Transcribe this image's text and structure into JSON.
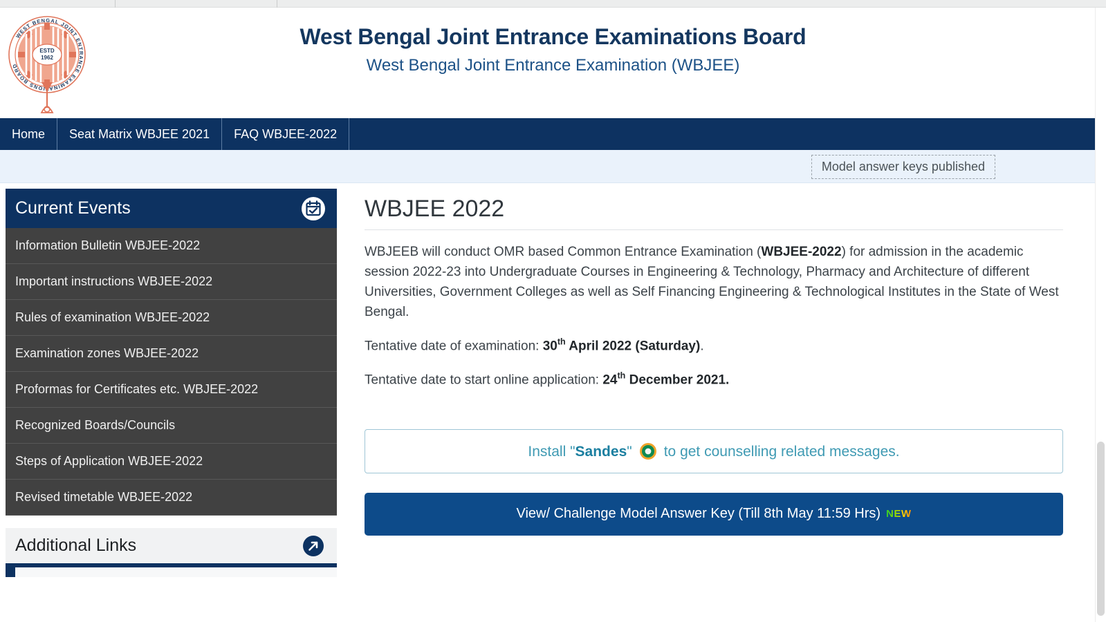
{
  "browser": {
    "tab_separators": [
      166,
      400
    ]
  },
  "header": {
    "logo_alt": "West Bengal Joint Entrance Examinations Board emblem",
    "logo_ring_text": "WEST BENGAL JOINT ENTRANCE EXAMINATIONS BOARD",
    "logo_estd_line1": "ESTD",
    "logo_estd_line2": "1962",
    "title": "West Bengal Joint Entrance Examinations Board",
    "subtitle": "West Bengal Joint Entrance Examination (WBJEE)"
  },
  "nav": {
    "items": [
      {
        "label": "Home"
      },
      {
        "label": "Seat Matrix WBJEE 2021"
      },
      {
        "label": "FAQ WBJEE-2022"
      }
    ]
  },
  "notice": {
    "text": "Model answer keys published"
  },
  "sidebar": {
    "current_events": {
      "title": "Current Events",
      "icon": "calendar-check-icon",
      "items": [
        {
          "label": "Information Bulletin WBJEE-2022"
        },
        {
          "label": "Important instructions WBJEE-2022"
        },
        {
          "label": "Rules of examination WBJEE-2022"
        },
        {
          "label": "Examination zones WBJEE-2022"
        },
        {
          "label": "Proformas for Certificates etc. WBJEE-2022"
        },
        {
          "label": "Recognized Boards/Councils"
        },
        {
          "label": "Steps of Application WBJEE-2022"
        },
        {
          "label": "Revised timetable WBJEE-2022"
        }
      ]
    },
    "additional_links": {
      "title": "Additional Links",
      "icon": "external-link-arrow-icon"
    }
  },
  "main": {
    "page_title": "WBJEE 2022",
    "intro_part1": "WBJEEB will conduct OMR based Common Entrance Examination (",
    "intro_bold": "WBJEE-2022",
    "intro_part2": ") for admission in the academic session 2022-23 into Undergraduate Courses in Engineering & Technology, Pharmacy and Architecture of different Universities, Government Colleges as well as Self Financing Engineering & Technological Institutes in the State of West Bengal.",
    "exam_date_label": "Tentative date of examination: ",
    "exam_date_day": "30",
    "exam_date_sup": "th",
    "exam_date_rest": " April 2022 (Saturday)",
    "exam_date_period": ".",
    "application_date_label": "Tentative date to start online application: ",
    "application_date_day": "24",
    "application_date_sup": "th",
    "application_date_rest": " December 2021.",
    "sandes": {
      "prefix": "Install \"",
      "brand": "Sandes",
      "suffix_quote": "\"",
      "icon": "sandes-app-icon",
      "suffix": "to get counselling related messages."
    },
    "answer_key_button": {
      "label": "View/ Challenge Model Answer Key (Till 8th May 11:59 Hrs)",
      "badge": "NEW"
    }
  },
  "colors": {
    "brand_navy": "#0d3261",
    "button_blue": "#0d4b8a",
    "sidebar_dark": "#414141",
    "notice_band": "#eaf2fb",
    "logo_orange": "#e0755a",
    "sandes_teal": "#3f9ab3"
  }
}
